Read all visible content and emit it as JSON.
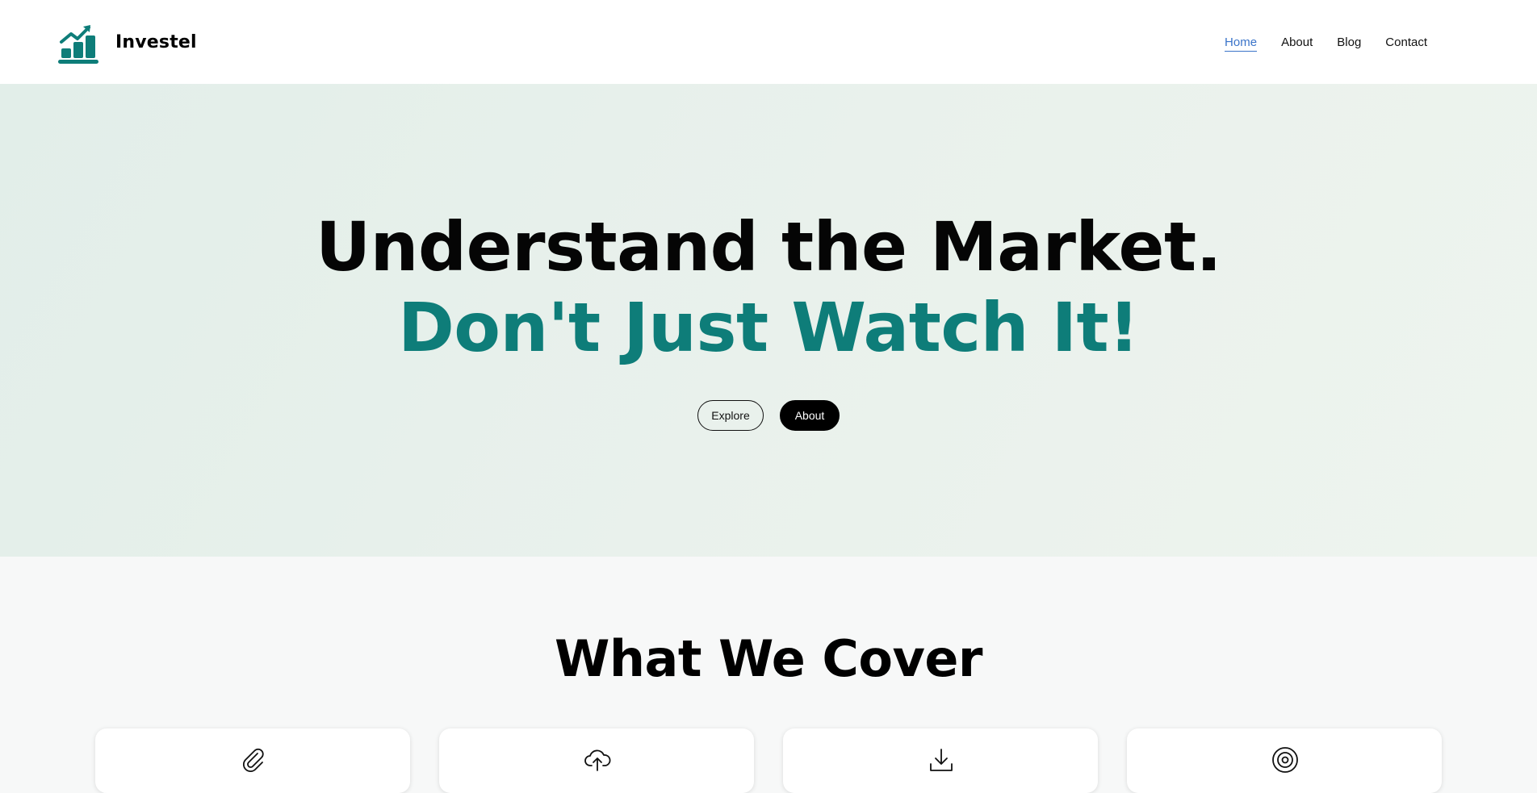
{
  "brand": {
    "name": "Investel",
    "logo_icon": "growth-chart-icon",
    "accent_color": "#0e7d79"
  },
  "nav": {
    "items": [
      {
        "label": "Home",
        "active": true
      },
      {
        "label": "About",
        "active": false
      },
      {
        "label": "Blog",
        "active": false
      },
      {
        "label": "Contact",
        "active": false
      }
    ],
    "active_color": "#3b74c9"
  },
  "hero": {
    "headline_line1": "Understand the Market.",
    "headline_line2": "Don't Just Watch It!",
    "buttons": {
      "explore_label": "Explore",
      "about_label": "About"
    }
  },
  "cover": {
    "title": "What We Cover",
    "cards": [
      {
        "icon": "paperclip-icon"
      },
      {
        "icon": "cloud-upload-icon"
      },
      {
        "icon": "download-icon"
      },
      {
        "icon": "target-icon"
      }
    ]
  }
}
